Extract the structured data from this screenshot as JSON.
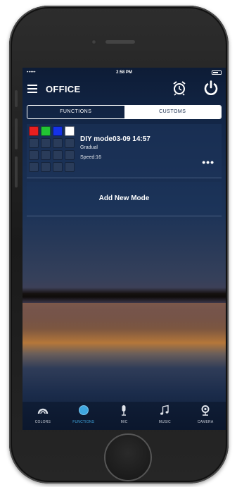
{
  "status_bar": {
    "carrier": "•••••",
    "time": "2:58 PM"
  },
  "header": {
    "title": "OFFICE"
  },
  "segments": {
    "functions_label": "FUNCTIONS",
    "customs_label": "CUSTOMS",
    "selected": "CUSTOMS"
  },
  "mode": {
    "name": "DIY mode03-09 14:57",
    "transition": "Gradual",
    "speed": "Speed:16",
    "more": "•••",
    "colors": [
      "#e81f1f",
      "#22c533",
      "#1532e8",
      "#ffffff"
    ]
  },
  "add_mode_label": "Add New Mode",
  "tabs": [
    {
      "label": "COLORS",
      "icon": "colors-icon",
      "active": false
    },
    {
      "label": "FUNCTIONS",
      "icon": "functions-icon",
      "active": true
    },
    {
      "label": "MIC",
      "icon": "mic-icon",
      "active": false
    },
    {
      "label": "MUSIC",
      "icon": "music-icon",
      "active": false
    },
    {
      "label": "CAMERA",
      "icon": "camera-icon",
      "active": false
    }
  ],
  "colors": {
    "accent": "#3fa7e0"
  }
}
